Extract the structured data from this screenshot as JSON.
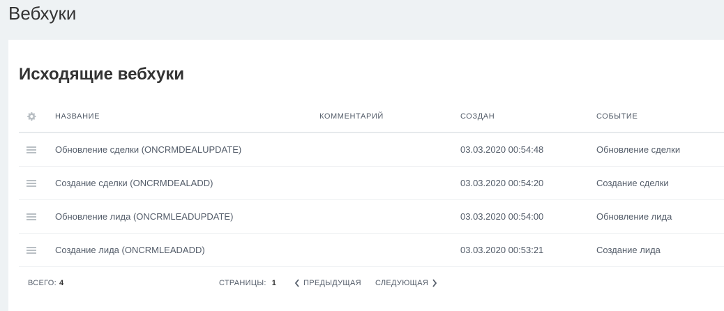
{
  "header": {
    "title": "Вебхуки"
  },
  "section": {
    "title": "Исходящие вебхуки"
  },
  "table": {
    "columns": {
      "name": "НАЗВАНИЕ",
      "comment": "КОММЕНТАРИЙ",
      "created": "СОЗДАН",
      "event": "СОБЫТИЕ"
    },
    "rows": [
      {
        "name": "Обновление сделки (ONCRMDEALUPDATE)",
        "comment": "",
        "created": "03.03.2020 00:54:48",
        "event": "Обновление сделки"
      },
      {
        "name": "Создание сделки (ONCRMDEALADD)",
        "comment": "",
        "created": "03.03.2020 00:54:20",
        "event": "Создание сделки"
      },
      {
        "name": "Обновление лида (ONCRMLEADUPDATE)",
        "comment": "",
        "created": "03.03.2020 00:54:00",
        "event": "Обновление лида"
      },
      {
        "name": "Создание лида (ONCRMLEADADD)",
        "comment": "",
        "created": "03.03.2020 00:53:21",
        "event": "Создание лида"
      }
    ]
  },
  "footer": {
    "total_label": "ВСЕГО:",
    "total_value": "4",
    "pages_label": "СТРАНИЦЫ:",
    "current_page": "1",
    "prev_label": "ПРЕДЫДУЩАЯ",
    "next_label": "СЛЕДУЮЩАЯ"
  }
}
